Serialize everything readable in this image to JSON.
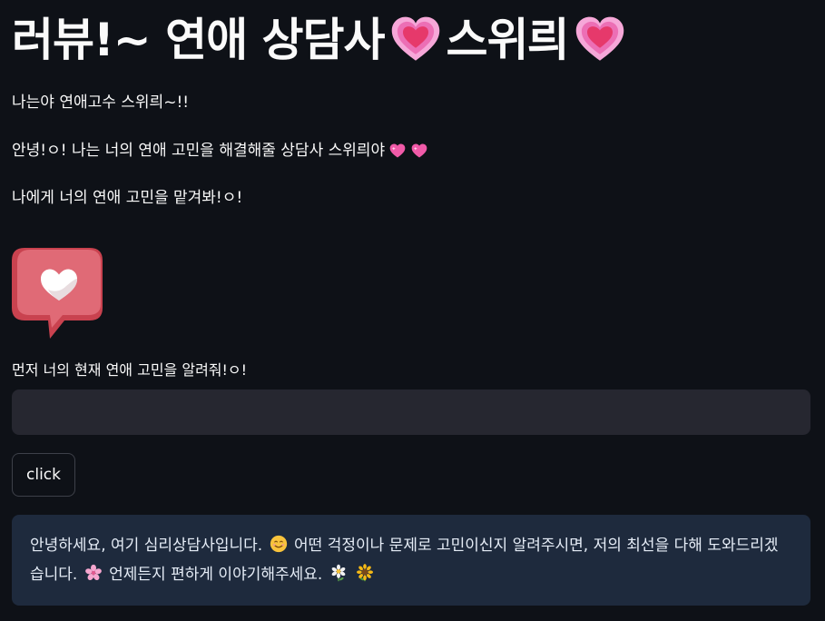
{
  "header": {
    "title_part1": "러뷰!~ 연애 상담사",
    "title_part2": "스위릐"
  },
  "intro": {
    "line1": "나는야 연애고수 스위릐~!!",
    "line2": "안녕!ㅇ! 나는 너의 연애 고민을 해결해줄 상담사 스위릐야",
    "line3": "나에게 너의 연애 고민을 맡겨봐!ㅇ!"
  },
  "form": {
    "label": "먼저 너의 현재 연애 고민을 알려줘!ㅇ!",
    "input_value": "",
    "button_label": "click"
  },
  "response": {
    "part1": "안녕하세요, 여기 심리상담사입니다.",
    "part2": "어떤 걱정이나 문제로 고민이신지 알려주시면, 저의 최선을 다해 도와드리겠습니다.",
    "part3": "언제든지 편하게 이야기해주세요."
  },
  "icons": {
    "title_heart": "growing-heart-icon",
    "small_heart": "sparkling-heart-icon",
    "heart_image": "heart-speech-bubble-icon",
    "smile": "smiling-face-icon",
    "blossom": "cherry-blossom-icon",
    "daisy": "daisy-icon",
    "sunflower": "sunflower-icon"
  },
  "colors": {
    "background": "#0e1117",
    "input_bg": "#262730",
    "response_bg": "#1e2a3d",
    "text": "#fafafa",
    "heart_pink": "#f472b6",
    "heart_red": "#e11d48"
  }
}
